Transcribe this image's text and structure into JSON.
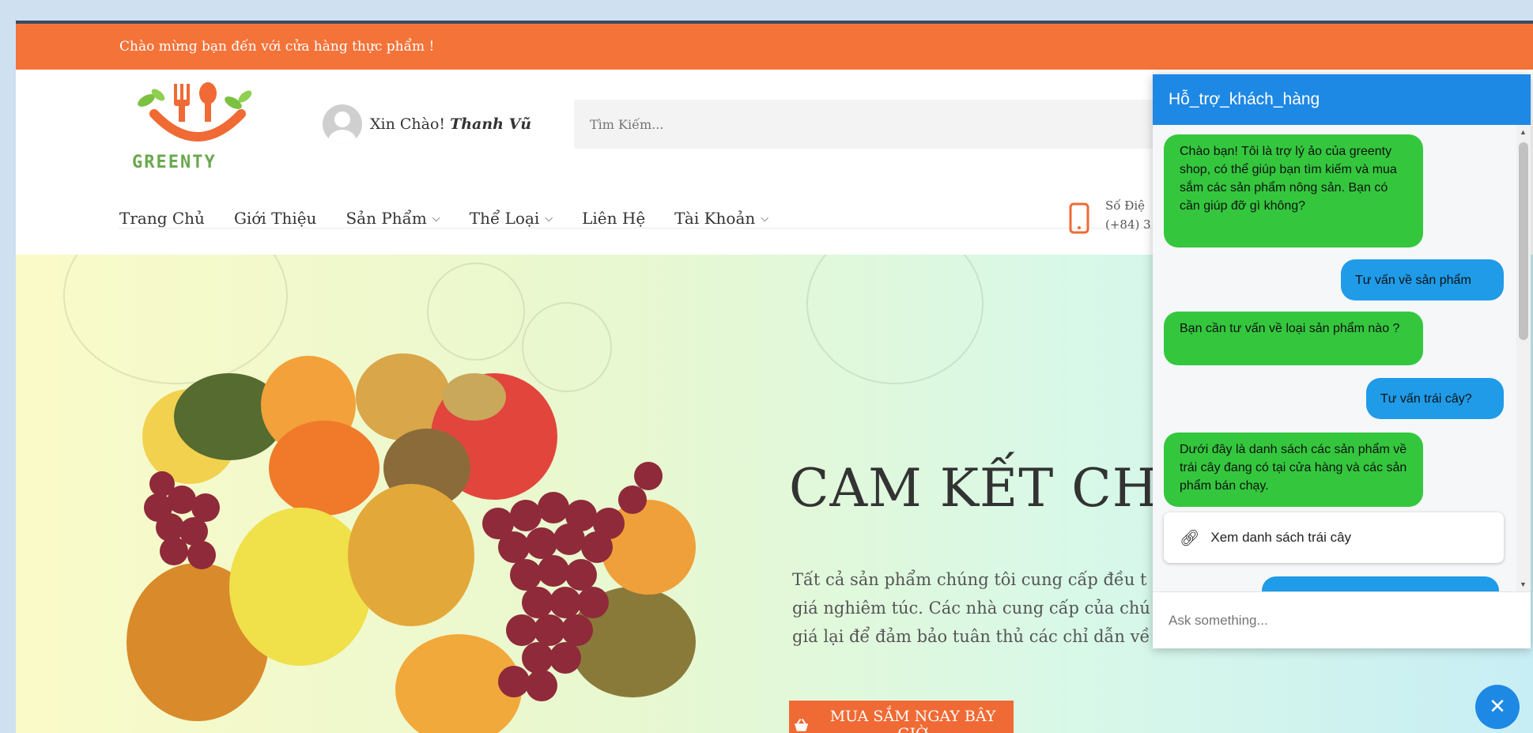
{
  "topbar": {
    "welcome": "Chào mừng bạn đến với cửa hàng thực phẩm !"
  },
  "header": {
    "logo_text": "GREENTY",
    "greeting": "Xin Chào!",
    "username": "Thanh Vũ",
    "search_placeholder": "Tìm Kiếm...",
    "phone_label": "Số Điệ",
    "phone_number": "(+84) 3"
  },
  "nav": {
    "items": [
      {
        "label": "Trang Chủ",
        "dropdown": false
      },
      {
        "label": "Giới Thiệu",
        "dropdown": false
      },
      {
        "label": "Sản Phẩm",
        "dropdown": true
      },
      {
        "label": "Thể Loại",
        "dropdown": true
      },
      {
        "label": "Liên Hệ",
        "dropdown": false
      },
      {
        "label": "Tài Khoản",
        "dropdown": true
      }
    ],
    "chevron": "⌄"
  },
  "hero": {
    "title": "CAM KẾT CHẤT",
    "text_lines": [
      "Tất cả sản phẩm chúng tôi cung cấp đều t",
      "giá nghiêm túc. Các nhà cung cấp của chú",
      "giá lại để đảm bảo tuân thủ các chỉ dẫn về"
    ],
    "button_label": "MUA SẮM NGAY BÂY GIỜ"
  },
  "chat": {
    "title": "Hỗ_trợ_khách_hàng",
    "messages": [
      {
        "from": "bot",
        "text": "Chào bạn! Tôi là trợ lý ảo của greenty shop, có thể giúp bạn tìm kiếm và mua sắm các sản phẩm nông sản. Bạn có cần giúp đỡ gì không?"
      },
      {
        "from": "user",
        "text": "Tư vấn về sản phẩm"
      },
      {
        "from": "bot",
        "text": "Bạn cần tư vấn về loại sản phẩm nào ?"
      },
      {
        "from": "user",
        "text": "Tư vấn trái cây?"
      },
      {
        "from": "bot",
        "text": "Dưới đây là danh sách các sản phẩm về trái cây đang có tại cửa hàng và các sản phẩm bán chạy."
      }
    ],
    "option_label": "Xem danh sách trái cây",
    "input_placeholder": "Ask something...",
    "close_symbol": "✕"
  },
  "colors": {
    "brand_orange": "#f47339",
    "chat_blue": "#1e88e5",
    "bot_green": "#34c73e",
    "user_blue": "#1f9be8"
  }
}
